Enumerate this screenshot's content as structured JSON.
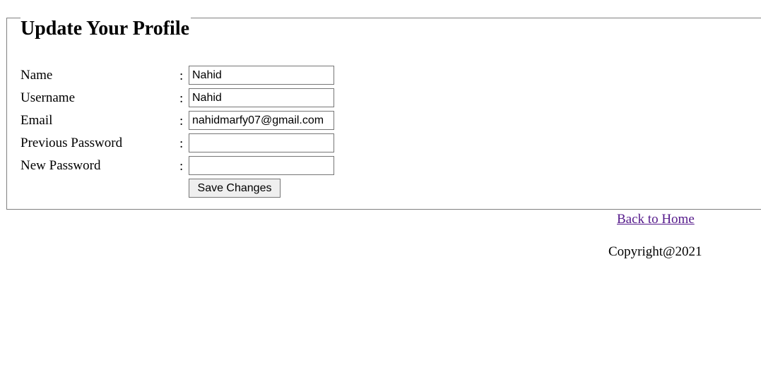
{
  "form": {
    "legend": "Update Your Profile",
    "separator": ":",
    "fields": [
      {
        "label": "Name",
        "value": "Nahid",
        "type": "text"
      },
      {
        "label": "Username",
        "value": "Nahid",
        "type": "text"
      },
      {
        "label": "Email",
        "value": "nahidmarfy07@gmail.com",
        "type": "text"
      },
      {
        "label": "Previous Password",
        "value": "",
        "type": "password"
      },
      {
        "label": "New Password",
        "value": "",
        "type": "password"
      }
    ],
    "submit_label": "Save Changes"
  },
  "footer": {
    "back_link": "Back to Home",
    "copyright": "Copyright@2021"
  },
  "colors": {
    "link_visited": "#551a8b",
    "border": "#808080",
    "button_bg": "#efefef"
  }
}
